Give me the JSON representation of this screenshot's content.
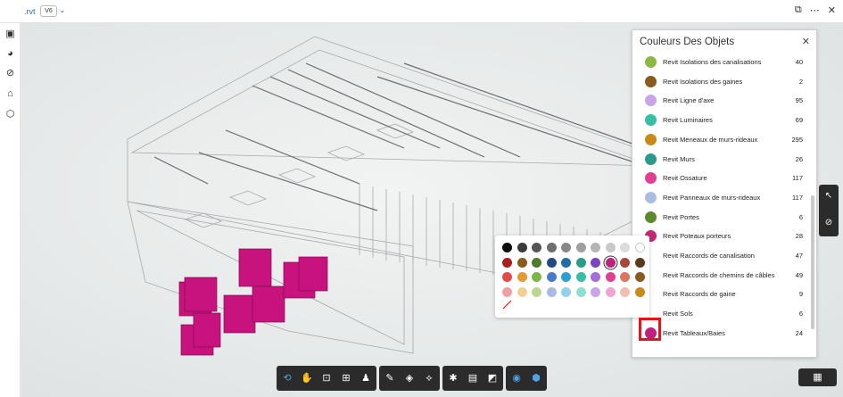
{
  "header": {
    "file_name": ".rvt",
    "version": "V6",
    "version_chevron": "chevron-down-icon",
    "right_icons": [
      "compare-icon",
      "more-icon",
      "close-icon"
    ]
  },
  "left_rail": {
    "icons": [
      "sheets-icon",
      "model-browser-icon",
      "issues-icon",
      "bookmark-icon",
      "cube-icon"
    ]
  },
  "panel": {
    "title": "Couleurs Des Objets",
    "close_glyph": "✕",
    "items": [
      {
        "label": "Revit Isolations des canalisations",
        "count": "40",
        "color": "#8db843"
      },
      {
        "label": "Revit Isolations des gaines",
        "count": "2",
        "color": "#8b5a1e"
      },
      {
        "label": "Revit Ligne d'axe",
        "count": "95",
        "color": "#c9a4e8"
      },
      {
        "label": "Revit Luminaires",
        "count": "69",
        "color": "#36bfa6"
      },
      {
        "label": "Revit Meneaux de murs-rideaux",
        "count": "295",
        "color": "#c98a1c"
      },
      {
        "label": "Revit Murs",
        "count": "26",
        "color": "#2a9a8a"
      },
      {
        "label": "Revit Ossature",
        "count": "117",
        "color": "#e23f93"
      },
      {
        "label": "Revit Panneaux de murs-rideaux",
        "count": "117",
        "color": "#a9bde0"
      },
      {
        "label": "Revit Portes",
        "count": "6",
        "color": "#5d8a2c"
      },
      {
        "label": "Revit Poteaux porteurs",
        "count": "28",
        "color": "#c42775"
      },
      {
        "label": "Revit Raccords de canalisation",
        "count": "47",
        "color": ""
      },
      {
        "label": "Revit Raccords de chemins de câbles",
        "count": "49",
        "color": ""
      },
      {
        "label": "Revit Raccords de gaine",
        "count": "9",
        "color": ""
      },
      {
        "label": "Revit Sols",
        "count": "6",
        "color": ""
      },
      {
        "label": "Revit Tableaux/Baies",
        "count": "24",
        "color": "#c21e7d"
      }
    ]
  },
  "palette": {
    "rows": [
      [
        "#0c0c0c",
        "#3a3a3a",
        "#555555",
        "#6e6e6e",
        "#888888",
        "#9f9f9f",
        "#b5b5b5",
        "#c9c9c9",
        "#dcdcdc",
        "#ffffff"
      ],
      [
        "#a8201f",
        "#8b5a1e",
        "#4f7a2a",
        "#244a85",
        "#1e6fa8",
        "#2a9a8a",
        "#7b44c2",
        "#c21e7d",
        "#a8483a",
        "#5a3a1a"
      ],
      [
        "#e34a45",
        "#e49a2c",
        "#7db54a",
        "#4a7bd1",
        "#2c9fd6",
        "#36bfa6",
        "#a46de0",
        "#e23f93",
        "#e0735f",
        "#8b5a1e"
      ],
      [
        "#f0a0a0",
        "#f2cf95",
        "#b8d98f",
        "#a9bde0",
        "#8fd2ea",
        "#8fded0",
        "#c9a4e8",
        "#f0a4cf",
        "#f1bfb0",
        "#c98a1c"
      ]
    ],
    "selected": "#c21e7d",
    "no_color_icon": "no-color-icon"
  },
  "right_tools": [
    "select-cursor-icon",
    "markup-check-icon"
  ],
  "toolbar": {
    "groups": [
      [
        "orbit-icon",
        "pan-hand-icon",
        "fit-view-icon",
        "zoom-window-icon",
        "walk-person-icon"
      ],
      [
        "measure-icon",
        "section-box-icon",
        "explode-icon"
      ],
      [
        "settings-icon",
        "document-browser-icon",
        "properties-icon"
      ],
      [
        "visibility-eye-icon",
        "model-icon"
      ]
    ]
  },
  "grid_button_icon": "grid-icon"
}
